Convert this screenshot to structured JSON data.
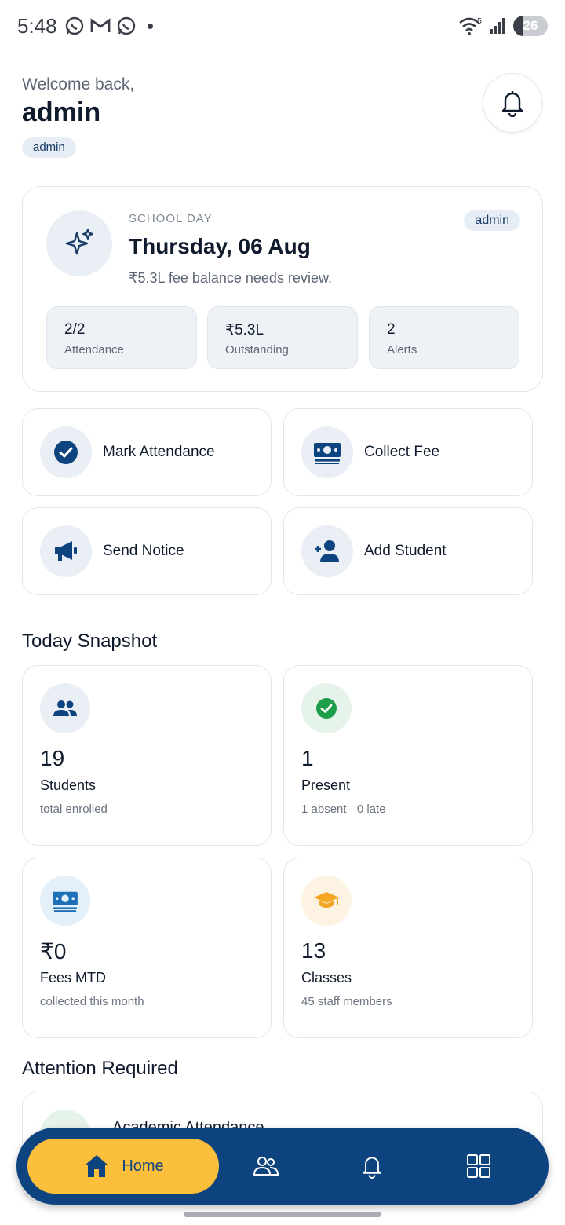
{
  "status_bar": {
    "time": "5:48",
    "battery": "26",
    "network_badge": "5"
  },
  "header": {
    "welcome": "Welcome back,",
    "username": "admin",
    "role": "admin"
  },
  "school_day": {
    "label": "SCHOOL DAY",
    "date": "Thursday, 06 Aug",
    "note": "₹5.3L fee balance needs review.",
    "role_chip": "admin",
    "metrics": [
      {
        "value": "2/2",
        "label": "Attendance"
      },
      {
        "value": "₹5.3L",
        "label": "Outstanding"
      },
      {
        "value": "2",
        "label": "Alerts"
      }
    ]
  },
  "actions": [
    {
      "label": "Mark Attendance",
      "icon": "check-circle-icon"
    },
    {
      "label": "Collect Fee",
      "icon": "money-icon"
    },
    {
      "label": "Send Notice",
      "icon": "megaphone-icon"
    },
    {
      "label": "Add Student",
      "icon": "add-person-icon"
    }
  ],
  "snapshot": {
    "title": "Today Snapshot",
    "cards": [
      {
        "value": "19",
        "name": "Students",
        "sub": "total enrolled",
        "icon": "people-icon"
      },
      {
        "value": "1",
        "name": "Present",
        "sub": "1 absent · 0 late",
        "icon": "check-circle-icon"
      },
      {
        "value": "₹0",
        "name": "Fees MTD",
        "sub": "collected this month",
        "icon": "money-icon"
      },
      {
        "value": "13",
        "name": "Classes",
        "sub": "45 staff members",
        "icon": "graduation-cap-icon"
      }
    ]
  },
  "attention": {
    "title": "Attention Required",
    "first_item": "Academic Attendance"
  },
  "nav": {
    "home": "Home"
  },
  "colors": {
    "primary": "#0d447f",
    "accent": "#fbbf3c",
    "success": "#1e9e4a",
    "warning": "#f5a623"
  }
}
